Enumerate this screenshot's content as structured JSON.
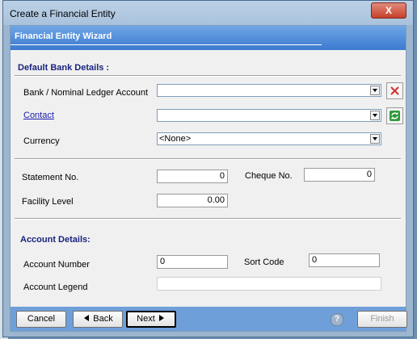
{
  "window": {
    "title": "Create a Financial Entity",
    "close_label": "X"
  },
  "header": {
    "title": "Financial Entity Wizard"
  },
  "bank_section": {
    "title": "Default Bank Details :",
    "bank_label": "Bank / Nominal Ledger Account",
    "bank_value": "",
    "contact_label": "Contact",
    "contact_value": "",
    "currency_label": "Currency",
    "currency_value": "<None>"
  },
  "numbers_section": {
    "statement_label": "Statement No.",
    "statement_value": "0",
    "cheque_label": "Cheque No.",
    "cheque_value": "0",
    "facility_label": "Facility Level",
    "facility_value": "0.00"
  },
  "account_section": {
    "title": "Account Details:",
    "account_number_label": "Account Number",
    "account_number_value": "0",
    "sort_code_label": "Sort Code",
    "sort_code_value": "0",
    "legend_label": "Account Legend",
    "legend_value": ""
  },
  "footer": {
    "cancel_label": "Cancel",
    "back_label": "Back",
    "next_label": "Next",
    "help_label": "?",
    "finish_label": "Finish"
  },
  "icons": {
    "clear": "clear-x-icon",
    "refresh": "refresh-icon",
    "back": "arrow-left-icon",
    "next": "arrow-right-icon",
    "help": "help-icon"
  },
  "colors": {
    "header_blue": "#3c7ad0",
    "section_title": "#1a237e",
    "clear_red": "#d32f2f",
    "refresh_green": "#2e9b3a"
  }
}
